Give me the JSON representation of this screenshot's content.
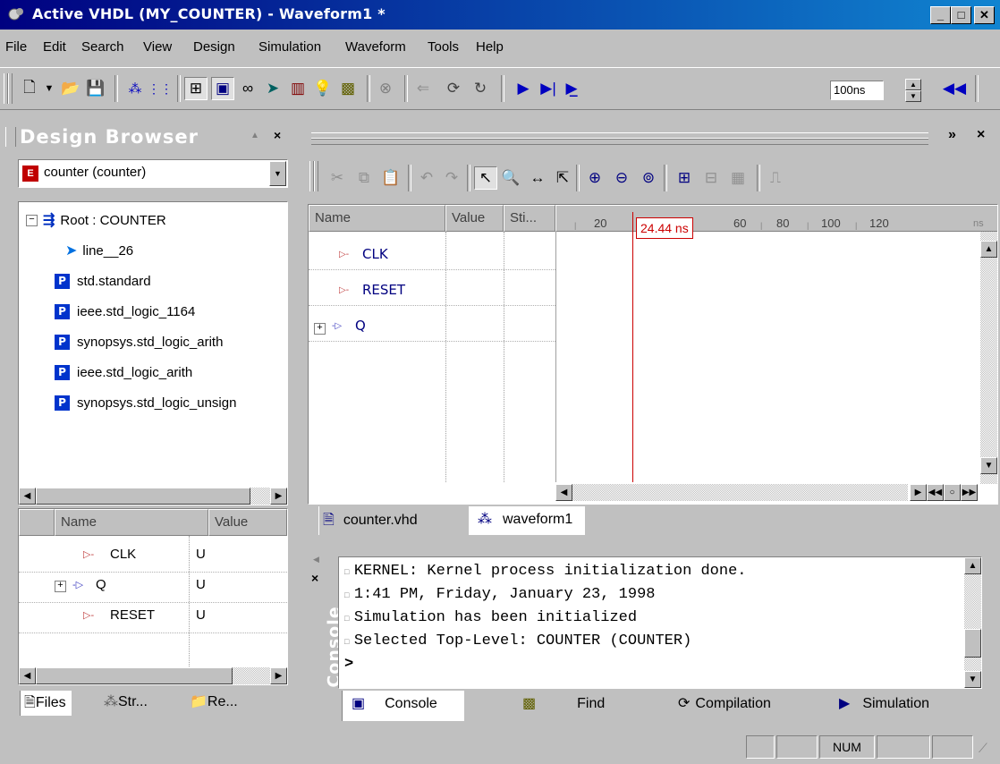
{
  "window": {
    "title": "Active VHDL (MY_COUNTER) - Waveform1 *"
  },
  "menu": [
    "File",
    "Edit",
    "Search",
    "View",
    "Design",
    "Simulation",
    "Waveform",
    "Tools",
    "Help"
  ],
  "toolbar": {
    "time_step": "100ns"
  },
  "design_browser": {
    "title": "Design Browser",
    "selected_unit": "counter (counter)",
    "tree": {
      "root": "Root : COUNTER",
      "child": "line__26",
      "packages": [
        "std.standard",
        "ieee.std_logic_1164",
        "synopsys.std_logic_arith",
        "ieee.std_logic_arith",
        "synopsys.std_logic_unsign"
      ]
    },
    "signals_table": {
      "headers": {
        "name": "Name",
        "value": "Value"
      },
      "rows": [
        {
          "name": "CLK",
          "value": "U"
        },
        {
          "name": "Q",
          "value": "U"
        },
        {
          "name": "RESET",
          "value": "U"
        }
      ]
    },
    "tabs": [
      "Files",
      "Str...",
      "Re..."
    ]
  },
  "waveform": {
    "headers": {
      "name": "Name",
      "value": "Value",
      "stim": "Sti..."
    },
    "ruler": {
      "ticks": [
        "20",
        "60",
        "80",
        "100",
        "120"
      ],
      "unit": "ns"
    },
    "cursor_label": "24.44 ns",
    "signals": [
      "CLK",
      "RESET",
      "Q"
    ],
    "doc_tabs": [
      "counter.vhd",
      "waveform1"
    ]
  },
  "console": {
    "side_label": "Console",
    "lines": [
      "KERNEL: Kernel process initialization done.",
      "1:41 PM, Friday, January 23, 1998",
      "Simulation has been initialized",
      "Selected Top-Level: COUNTER (COUNTER)"
    ],
    "prompt": ">",
    "tabs": [
      "Console",
      "Find",
      "Compilation",
      "Simulation"
    ]
  },
  "statusbar": {
    "num": "NUM"
  },
  "colors": {
    "title_start": "#000080",
    "title_end": "#1084d0",
    "cursor": "#cc0000",
    "signal_text": "#000080"
  }
}
